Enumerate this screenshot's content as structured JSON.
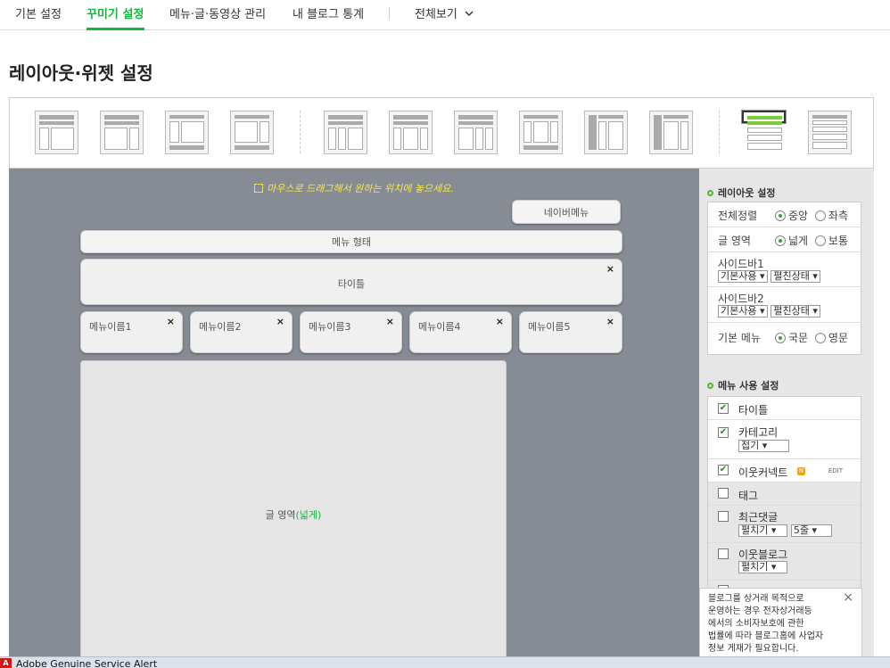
{
  "topnav": {
    "tabs": [
      {
        "label": "기본 설정"
      },
      {
        "label": "꾸미기 설정"
      },
      {
        "label": "메뉴·글·동영상 관리"
      },
      {
        "label": "내 블로그 통계"
      }
    ],
    "view_all": "전체보기",
    "active_index": 1
  },
  "page_title": "레이아웃·위젯 설정",
  "canvas": {
    "hint": "마우스로 드래그해서 원하는 위치에 놓으세요.",
    "naver_menu": "네이버메뉴",
    "menu_type": "메뉴 형태",
    "title_block": "타이틀",
    "menu_items": [
      "메뉴이름1",
      "메뉴이름2",
      "메뉴이름3",
      "메뉴이름4",
      "메뉴이름5"
    ],
    "content_label": "글 영역",
    "content_label_suffix": "(넓게)",
    "close_glyph": "×"
  },
  "layout_settings": {
    "header": "레이아웃 설정",
    "align_label": "전체정렬",
    "align_options": [
      "중앙",
      "좌측"
    ],
    "width_label": "글 영역",
    "width_options": [
      "넓게",
      "보통"
    ],
    "sidebar1_label": "사이드바1",
    "sidebar2_label": "사이드바2",
    "sidebar_use": "기본사용",
    "sidebar_state": "펼친상태",
    "menu_label": "기본 메뉴",
    "menu_options": [
      "국문",
      "영문"
    ]
  },
  "menu_settings": {
    "header": "메뉴 사용 설정",
    "items": [
      {
        "label": "타이틀",
        "checked": true
      },
      {
        "label": "카테고리",
        "checked": true,
        "select": "접기"
      },
      {
        "label": "이웃커넥트",
        "checked": true,
        "badge": "N",
        "edit": "EDIT"
      },
      {
        "label": "태그",
        "checked": false
      },
      {
        "label": "최근댓글",
        "checked": false,
        "select": "펼치기",
        "select2": "5줄"
      },
      {
        "label": "이웃블로그",
        "checked": false,
        "select": "펼치기"
      }
    ]
  },
  "notice": {
    "lines": [
      "블로그를 상거래 목적으로",
      "운영하는 경우 전자상거래등",
      "에서의 소비자보호에 관한",
      "법률에 따라 블로그홈에 사업자",
      "정보 게재가 필요합니다."
    ],
    "close": "×"
  },
  "taskbar": {
    "logo": "A",
    "title": "Adobe Genuine Service Alert"
  },
  "colors": {
    "accent_green": "#17b53e",
    "canvas_bg": "#868b94",
    "hint_yellow": "#f6e84a"
  }
}
